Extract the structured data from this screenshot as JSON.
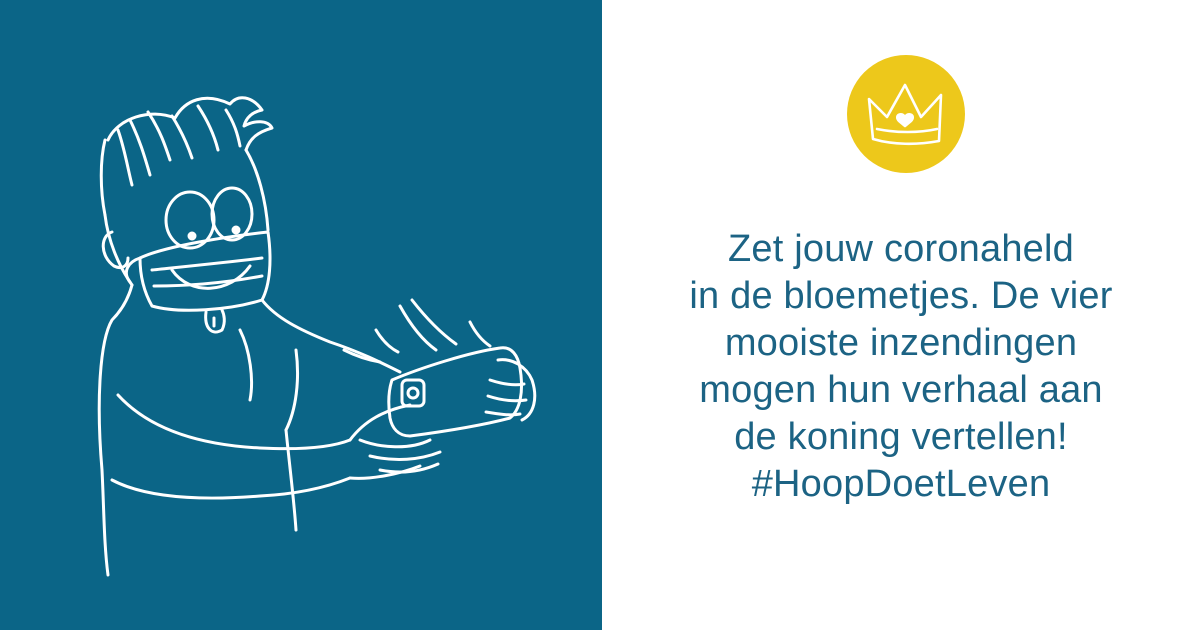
{
  "colors": {
    "panel_blue": "#0b6587",
    "badge_yellow": "#edc81b",
    "text_blue": "#1c6384",
    "line_white": "#ffffff"
  },
  "illustration": {
    "icon": "person-with-face-mask-taking-phone-photo"
  },
  "badge": {
    "icon": "crown-with-heart-icon"
  },
  "message": {
    "lines": [
      "Zet jouw coronaheld",
      "in de bloemetjes. De vier",
      "mooiste inzendingen",
      "mogen hun verhaal aan",
      "de koning vertellen!",
      "#HoopDoetLeven"
    ]
  }
}
